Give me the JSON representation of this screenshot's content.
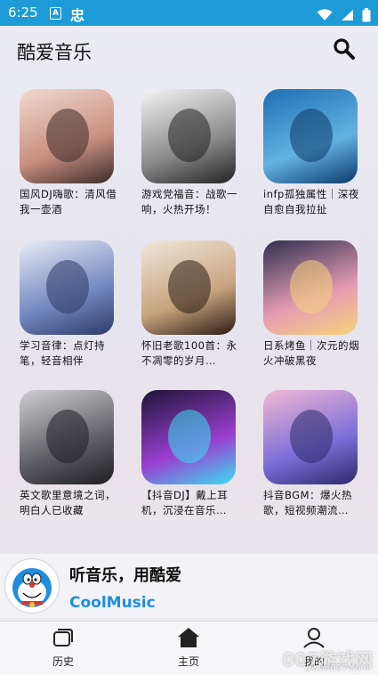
{
  "status": {
    "time": "6:25",
    "icon_a": "A",
    "icon_b": "忠"
  },
  "app": {
    "title": "酷爱音乐",
    "search_icon": "search-icon"
  },
  "playlists": [
    {
      "title": "国风DJ嗨歌：清风借我一壶酒",
      "colors": [
        "#f1d9cf",
        "#c98f7e",
        "#3a2a2a"
      ]
    },
    {
      "title": "游戏党福音：战歌一响，火热开场！",
      "colors": [
        "#f5f5f5",
        "#8a8a8a",
        "#222222"
      ]
    },
    {
      "title": "infp孤独属性｜深夜自愈自我拉扯",
      "colors": [
        "#1f6fb3",
        "#63b2e2",
        "#0b3a6a"
      ]
    },
    {
      "title": "学习音律：点灯持笔，轻音相伴",
      "colors": [
        "#e9ecf6",
        "#7187bf",
        "#2c3a66"
      ]
    },
    {
      "title": "怀旧老歌100首：永不凋零的岁月…",
      "colors": [
        "#efe7db",
        "#c8a37d",
        "#2a1b14"
      ]
    },
    {
      "title": "日系烤鱼｜次元的烟火冲破黑夜",
      "colors": [
        "#2e2f4f",
        "#e59cb2",
        "#f6d37a"
      ]
    },
    {
      "title": "英文歌里意境之词，明白人已收藏",
      "colors": [
        "#cfcfd3",
        "#5e5e64",
        "#1d1d22"
      ]
    },
    {
      "title": "【抖音DJ】戴上耳机，沉浸在音乐…",
      "colors": [
        "#1e1436",
        "#9a3fd1",
        "#39e0f0"
      ]
    },
    {
      "title": "抖音BGM：爆火热歌，短视频潮流…",
      "colors": [
        "#f3b8d5",
        "#7a6ed8",
        "#2b2a68"
      ]
    }
  ],
  "player": {
    "line1": "听音乐，用酷爱",
    "line2": "CoolMusic"
  },
  "nav": [
    {
      "label": "历史",
      "icon": "history-icon"
    },
    {
      "label": "主页",
      "icon": "home-icon"
    },
    {
      "label": "我的",
      "icon": "profile-icon"
    }
  ],
  "watermark": {
    "text": "007游戏网",
    "sub": "www.i007.com"
  }
}
